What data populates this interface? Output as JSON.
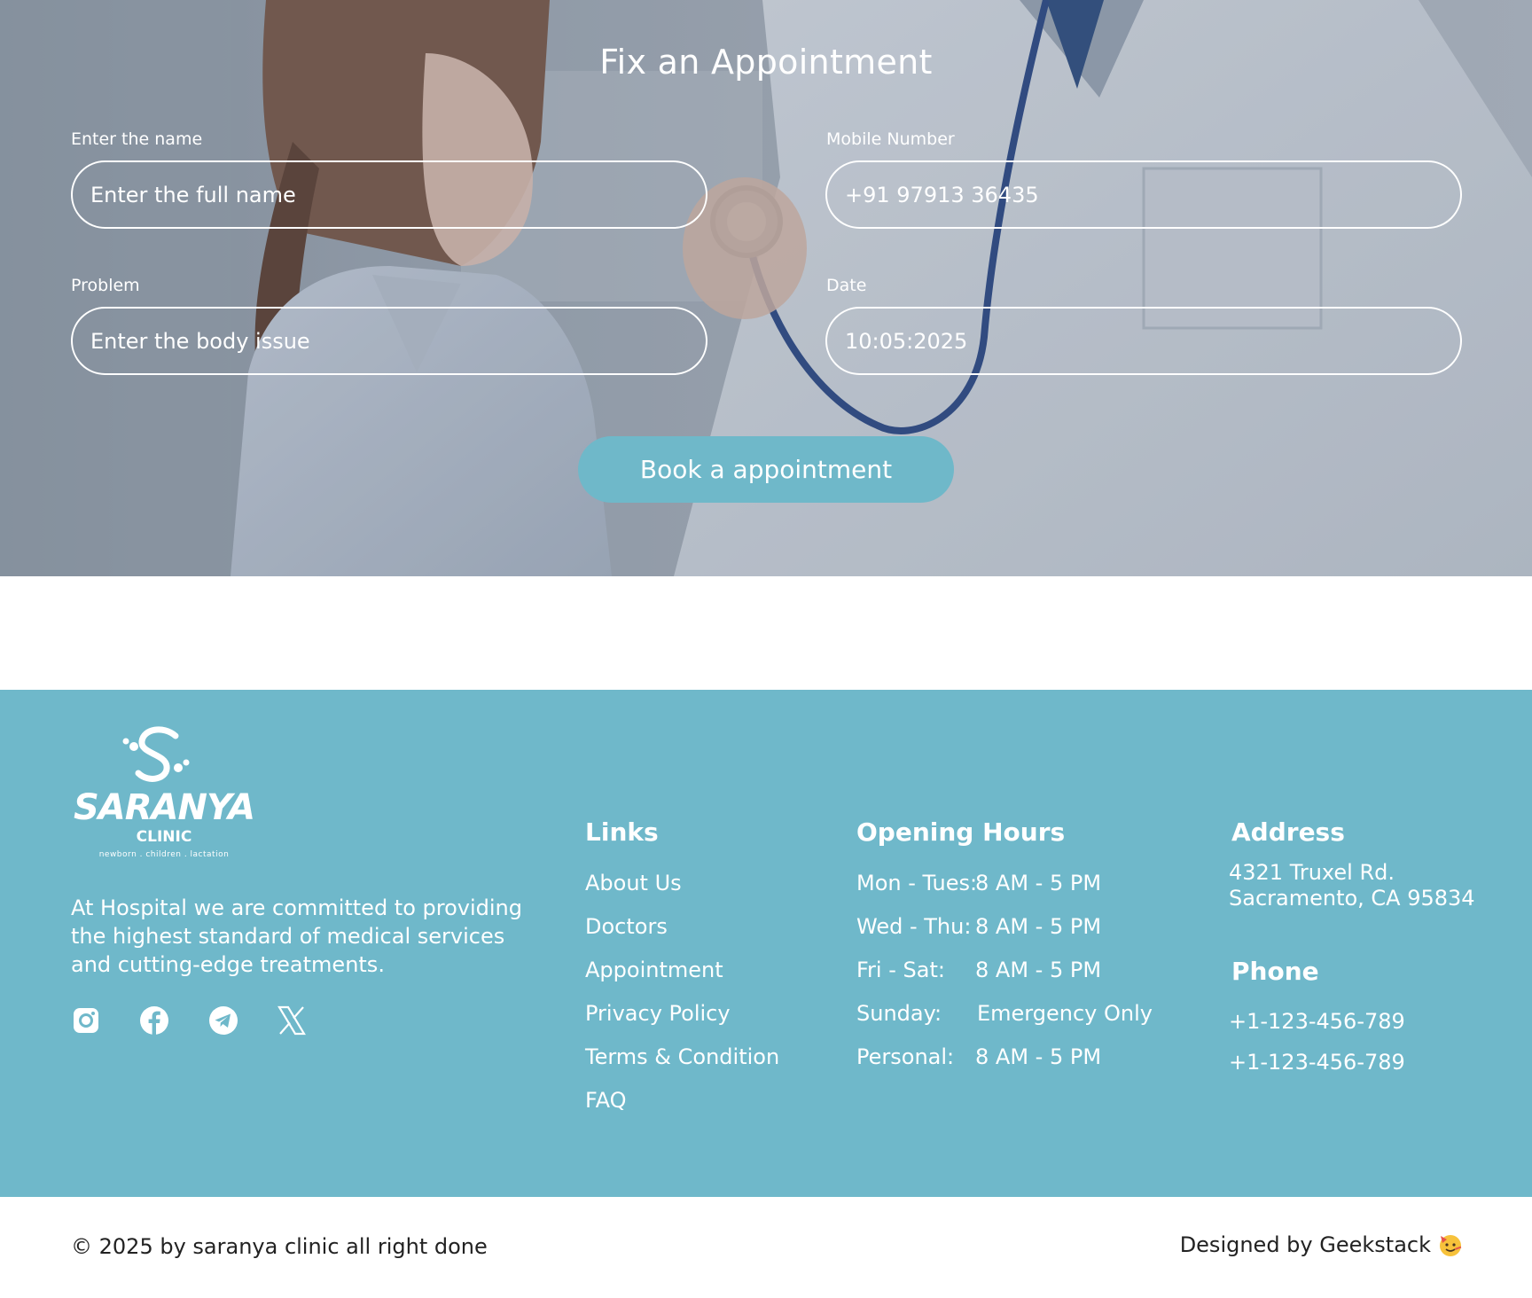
{
  "appointment": {
    "title": "Fix an Appointment",
    "name_label": "Enter the name",
    "name_placeholder": "Enter the full name",
    "mobile_label": "Mobile Number",
    "mobile_value": "+91 97913 36435",
    "problem_label": "Problem",
    "problem_placeholder": "Enter the body issue",
    "date_label": "Date",
    "date_value": "10:05:2025",
    "book_button": "Book a appointment"
  },
  "footer": {
    "brand": {
      "name": "SARANYA",
      "sub": "CLINIC",
      "tagline": "newborn . children . lactation"
    },
    "about": "At Hospital we are committed to providing the highest standard of medical services and cutting-edge treatments.",
    "social_icons": [
      "instagram-icon",
      "facebook-icon",
      "telegram-icon",
      "x-icon"
    ],
    "links": {
      "heading": "Links",
      "items": [
        "About Us",
        "Doctors",
        "Appointment",
        "Privacy Policy",
        "Terms & Condition",
        "FAQ"
      ]
    },
    "hours": {
      "heading": "Opening Hours",
      "rows": [
        {
          "day": "Mon - Tues:",
          "time": "8 AM - 5 PM"
        },
        {
          "day": "Wed - Thu:",
          "time": "8 AM - 5 PM"
        },
        {
          "day": "Fri - Sat:",
          "time": "8 AM - 5 PM"
        },
        {
          "day": "Sunday:",
          "time": "Emergency Only"
        },
        {
          "day": "Personal:",
          "time": "8 AM - 5 PM"
        }
      ]
    },
    "address": {
      "heading": "Address",
      "line1": "4321 Truxel Rd.",
      "line2": "Sacramento, CA 95834"
    },
    "phone": {
      "heading": "Phone",
      "numbers": [
        "+1-123-456-789",
        "+1-123-456-789"
      ]
    }
  },
  "bottom": {
    "copyright": "© 2025 by saranya clinic all right done",
    "designed_by": "Designed by Geekstack"
  },
  "colors": {
    "footer_bg": "#6fb8ca",
    "button_bg": "#6fb8c9",
    "text_dark": "#222222"
  }
}
